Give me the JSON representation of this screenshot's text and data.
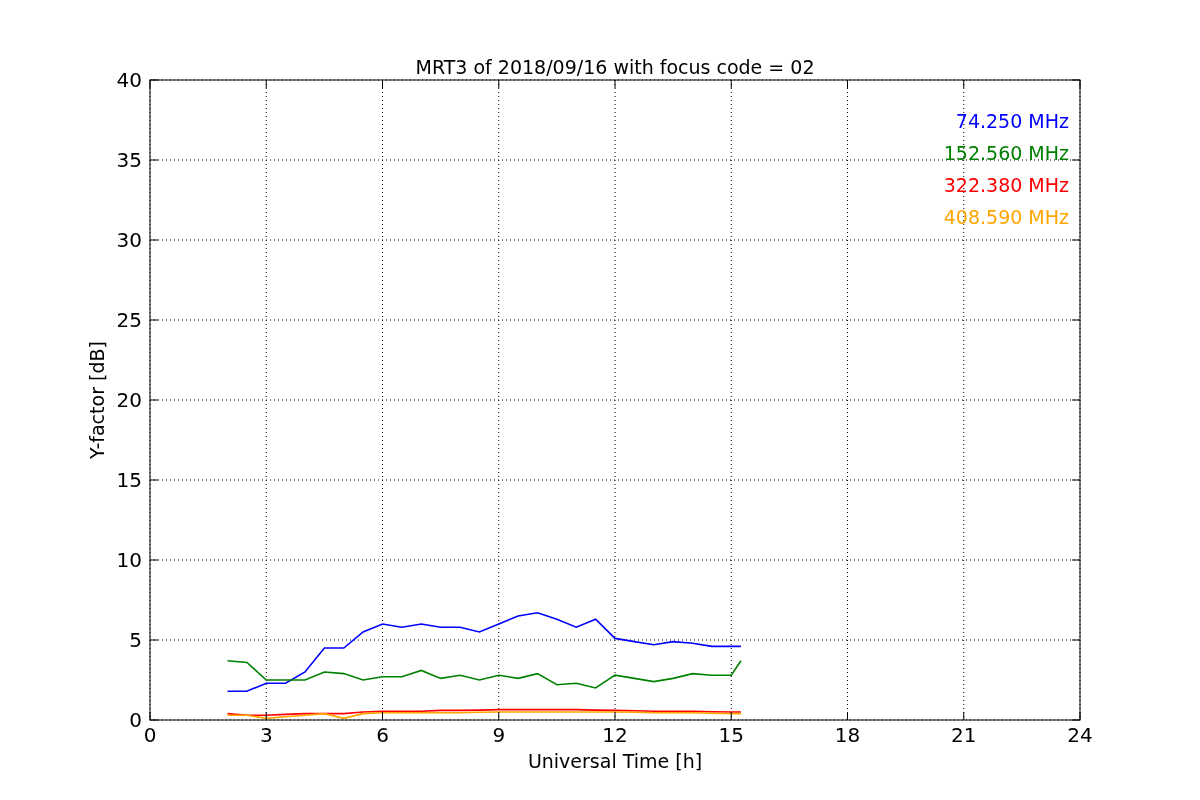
{
  "chart_data": {
    "type": "line",
    "title": "MRT3 of 2018/09/16 with focus code = 02",
    "xlabel": "Universal Time [h]",
    "ylabel": "Y-factor [dB]",
    "x": [
      2,
      2.5,
      3,
      3.5,
      4,
      4.5,
      5,
      5.5,
      6,
      6.5,
      7,
      7.5,
      8,
      8.5,
      9,
      9.5,
      10,
      10.5,
      11,
      11.5,
      12,
      12.5,
      13,
      13.5,
      14,
      14.5,
      15,
      15.25
    ],
    "series": [
      {
        "name": "74.250 MHz",
        "color": "#0000ff",
        "values": [
          1.8,
          1.8,
          2.3,
          2.3,
          3.0,
          4.5,
          4.5,
          5.5,
          6,
          5.8,
          6,
          5.8,
          5.8,
          5.5,
          6,
          6.5,
          6.7,
          6.3,
          5.8,
          6.3,
          5.1,
          4.9,
          4.7,
          4.9,
          4.8,
          4.6,
          4.6,
          4.6
        ]
      },
      {
        "name": "152.560 MHz",
        "color": "#008000",
        "values": [
          3.7,
          3.6,
          2.5,
          2.5,
          2.5,
          3.0,
          2.9,
          2.5,
          2.7,
          2.7,
          3.1,
          2.6,
          2.8,
          2.5,
          2.8,
          2.6,
          2.9,
          2.2,
          2.3,
          2.0,
          2.8,
          2.6,
          2.4,
          2.6,
          2.9,
          2.8,
          2.8,
          3.7
        ]
      },
      {
        "name": "322.380 MHz",
        "color": "#ff0000",
        "values": [
          0.4,
          0.3,
          0.3,
          0.35,
          0.4,
          0.4,
          0.4,
          0.5,
          0.55,
          0.55,
          0.55,
          0.6,
          0.6,
          0.62,
          0.65,
          0.65,
          0.65,
          0.65,
          0.65,
          0.62,
          0.6,
          0.58,
          0.55,
          0.55,
          0.55,
          0.52,
          0.5,
          0.5
        ]
      },
      {
        "name": "408.590 MHz",
        "color": "#ffa500",
        "values": [
          0.3,
          0.3,
          0.1,
          0.2,
          0.3,
          0.4,
          0.1,
          0.4,
          0.45,
          0.45,
          0.45,
          0.45,
          0.45,
          0.48,
          0.5,
          0.5,
          0.5,
          0.5,
          0.5,
          0.5,
          0.5,
          0.48,
          0.45,
          0.45,
          0.45,
          0.42,
          0.4,
          0.4
        ]
      }
    ],
    "xlim": [
      0,
      24
    ],
    "ylim": [
      0,
      40
    ],
    "xticks": [
      0,
      3,
      6,
      9,
      12,
      15,
      18,
      21,
      24
    ],
    "yticks": [
      0,
      5,
      10,
      15,
      20,
      25,
      30,
      35,
      40
    ],
    "grid": true
  }
}
